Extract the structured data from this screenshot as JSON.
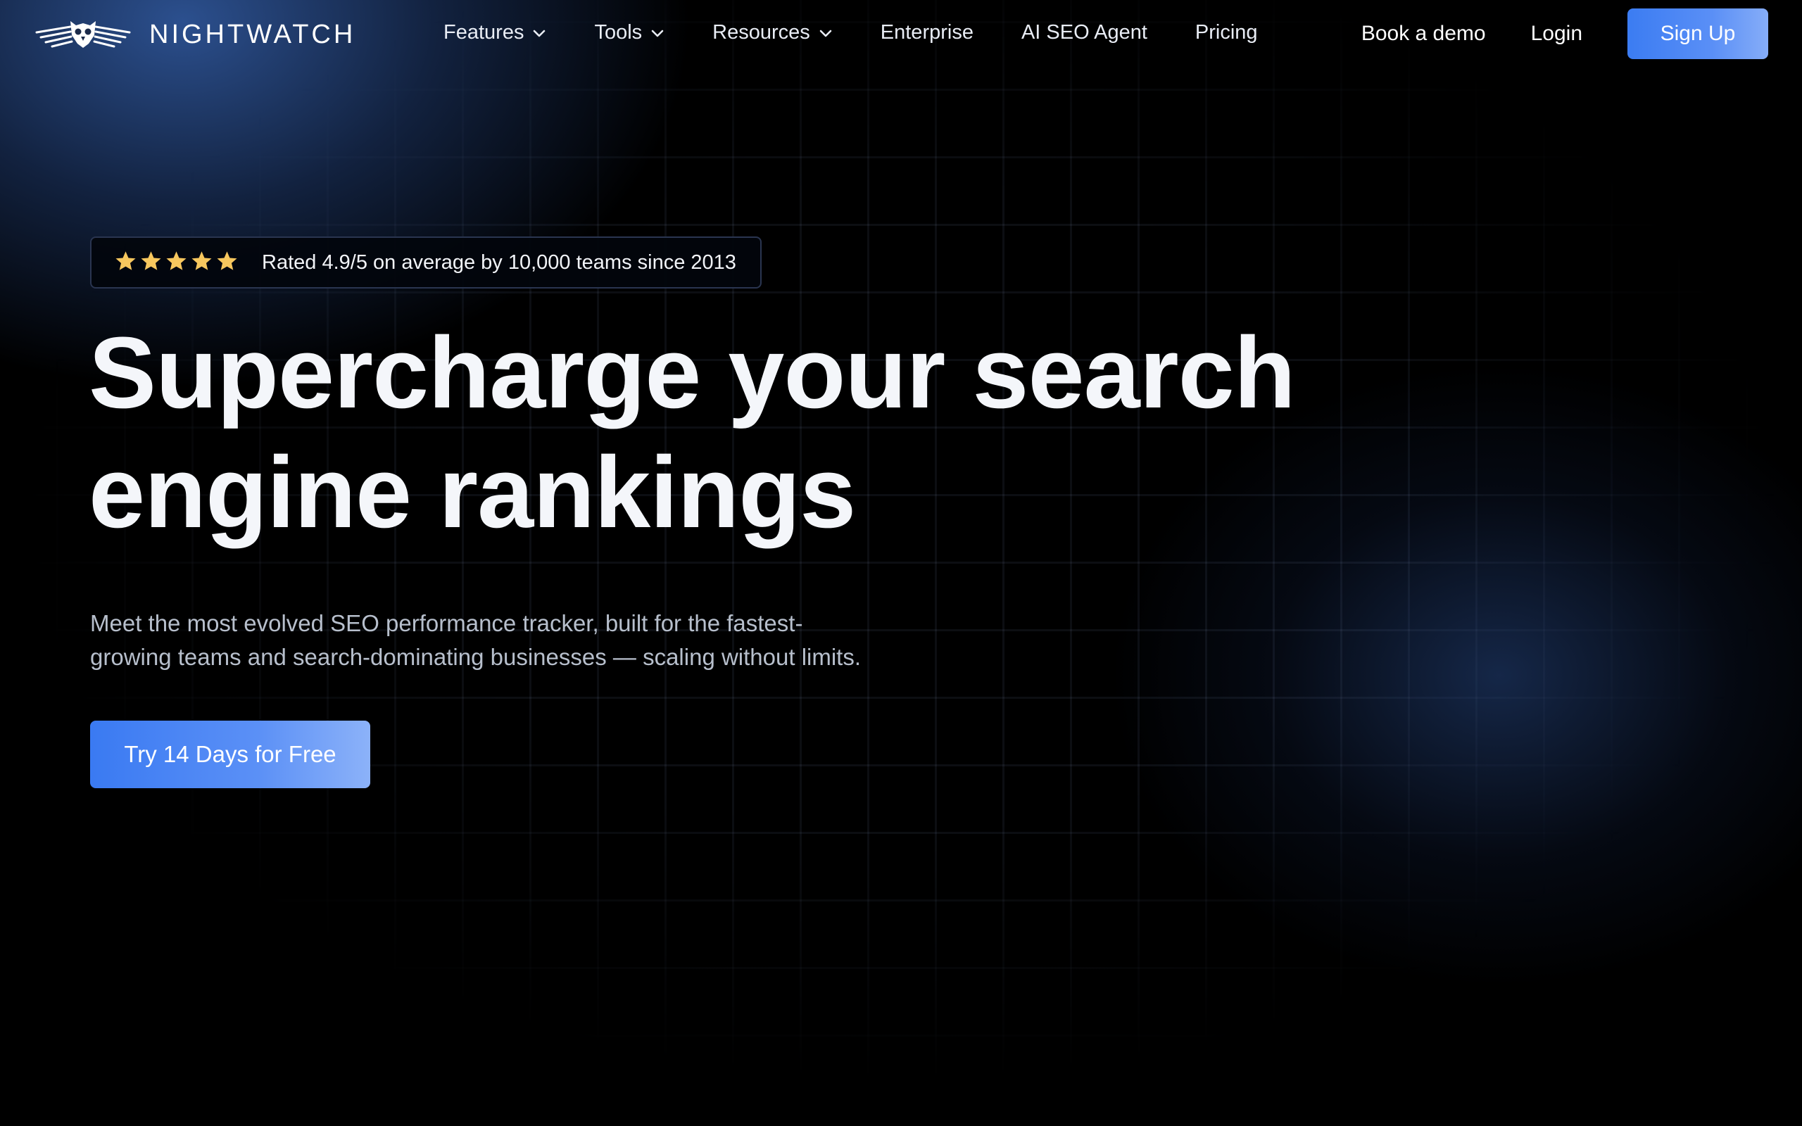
{
  "brand": {
    "name": "NIGHTWATCH",
    "logo_icon": "owl-wings-logo-icon"
  },
  "nav": {
    "items": [
      {
        "label": "Features",
        "has_dropdown": true
      },
      {
        "label": "Tools",
        "has_dropdown": true
      },
      {
        "label": "Resources",
        "has_dropdown": true
      },
      {
        "label": "Enterprise",
        "has_dropdown": false
      },
      {
        "label": "AI SEO Agent",
        "has_dropdown": false
      },
      {
        "label": "Pricing",
        "has_dropdown": false
      }
    ],
    "book_demo": "Book a demo",
    "login": "Login",
    "signup": "Sign Up"
  },
  "hero": {
    "rating": {
      "stars": 5,
      "text": "Rated 4.9/5 on average by 10,000 teams since 2013"
    },
    "headline_line1": "Supercharge your search",
    "headline_line2": "engine rankings",
    "subtext_line1": "Meet the most evolved SEO performance tracker, built for the fastest-",
    "subtext_line2": "growing teams and search-dominating businesses — scaling without limits.",
    "cta": "Try 14 Days for Free"
  },
  "colors": {
    "accent": "#3b7cf2",
    "star": "#f7c75e",
    "background": "#000000"
  }
}
